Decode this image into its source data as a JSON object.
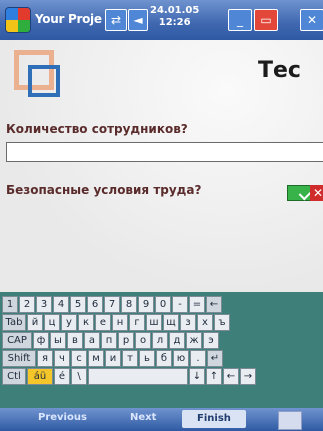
{
  "titlebar": {
    "app_title": "Your Proje",
    "time_top": "24.01.05",
    "time_bottom": "12:26"
  },
  "form": {
    "heading": "Тес",
    "question1": "Количество сотрудников?",
    "answer1": "",
    "question2": "Безопасные условия труда?",
    "checkbox_checked": true
  },
  "keyboard": {
    "row1": [
      "1",
      "2",
      "3",
      "4",
      "5",
      "6",
      "7",
      "8",
      "9",
      "0",
      "-",
      "=",
      "←"
    ],
    "row2": [
      "Tab",
      "й",
      "ц",
      "у",
      "к",
      "е",
      "н",
      "г",
      "ш",
      "щ",
      "з",
      "х",
      "ъ"
    ],
    "row3": [
      "CAP",
      "ф",
      "ы",
      "в",
      "а",
      "п",
      "р",
      "о",
      "л",
      "д",
      "ж",
      "э"
    ],
    "row4": [
      "Shift",
      "я",
      "ч",
      "с",
      "м",
      "и",
      "т",
      "ь",
      "б",
      "ю",
      ".",
      "↵"
    ],
    "row5": [
      "Ctl",
      "áü",
      "é",
      "\\",
      "",
      "↓",
      "↑",
      "←",
      "→"
    ]
  },
  "menubar": {
    "previous": "Previous",
    "next": "Next",
    "finish": "Finish"
  }
}
